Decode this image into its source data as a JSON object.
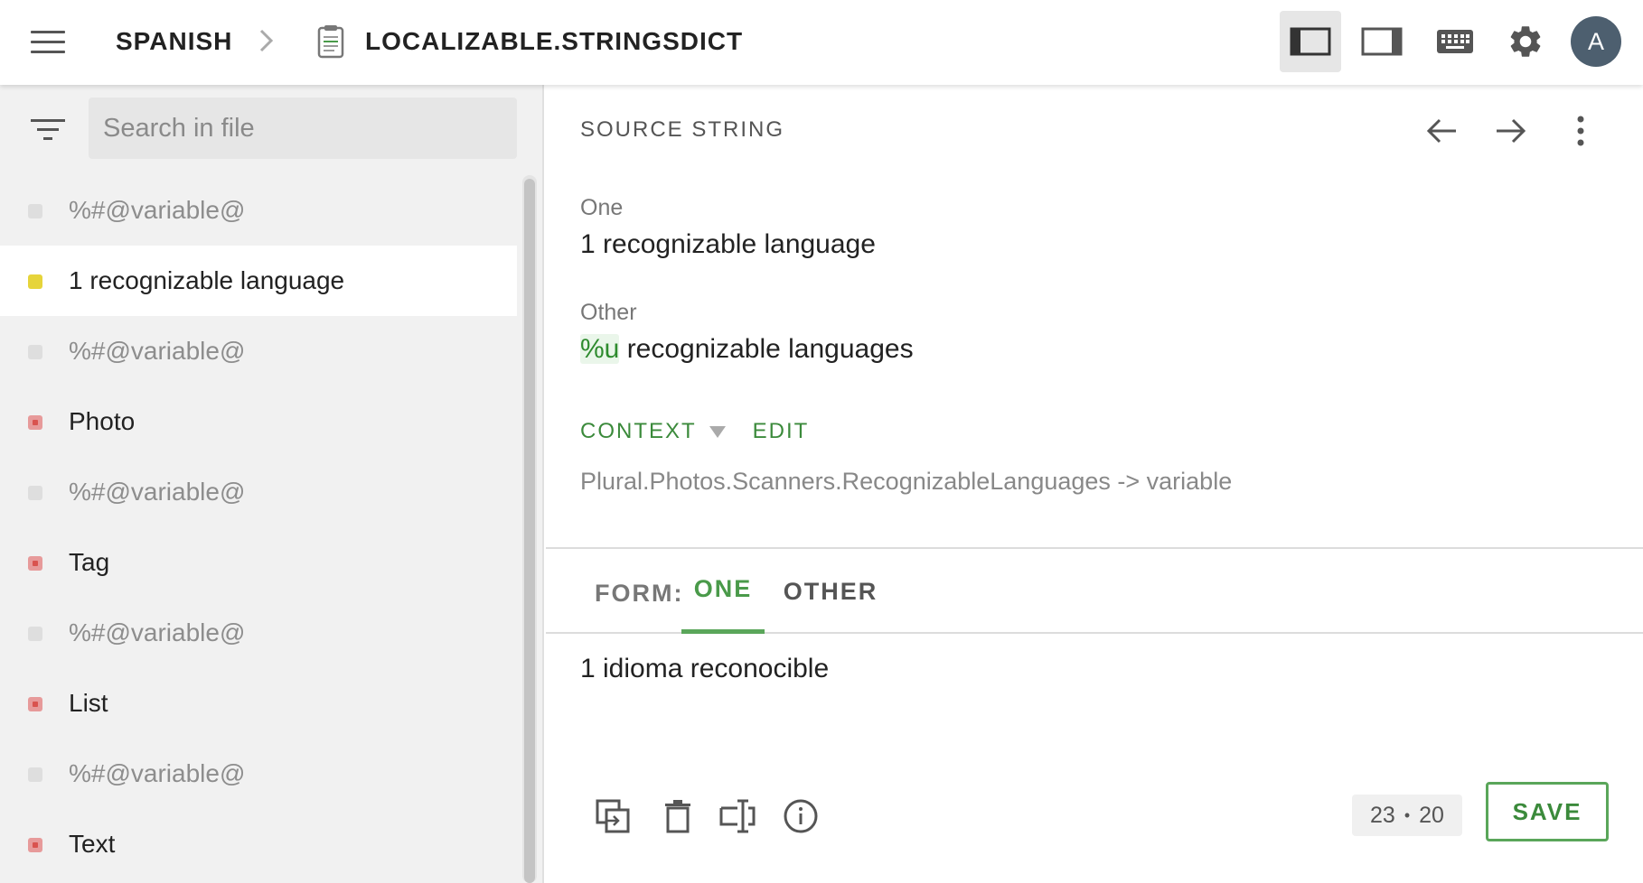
{
  "header": {
    "language": "SPANISH",
    "file_name": "LOCALIZABLE.STRINGSDICT",
    "avatar_initial": "A",
    "icons": [
      "menu-icon",
      "chevron-right-icon",
      "file-icon",
      "layout-left-panel-icon",
      "layout-right-panel-icon",
      "keyboard-icon",
      "gear-icon"
    ]
  },
  "sidebar": {
    "search_placeholder": "Search in file",
    "items": [
      {
        "label": "%#@variable@",
        "status": "gray",
        "muted": true
      },
      {
        "label": "1 recognizable language",
        "status": "yellow",
        "muted": false,
        "selected": true
      },
      {
        "label": "%#@variable@",
        "status": "gray",
        "muted": true
      },
      {
        "label": "Photo",
        "status": "red",
        "muted": false
      },
      {
        "label": "%#@variable@",
        "status": "gray",
        "muted": true
      },
      {
        "label": "Tag",
        "status": "red",
        "muted": false
      },
      {
        "label": "%#@variable@",
        "status": "gray",
        "muted": true
      },
      {
        "label": "List",
        "status": "red",
        "muted": false
      },
      {
        "label": "%#@variable@",
        "status": "gray",
        "muted": true
      },
      {
        "label": "Text",
        "status": "red",
        "muted": false
      }
    ]
  },
  "source": {
    "title": "SOURCE STRING",
    "forms": [
      {
        "label": "One",
        "text": "1 recognizable language"
      },
      {
        "label": "Other",
        "placeholder": "%u",
        "text": " recognizable languages"
      }
    ],
    "context_label": "CONTEXT",
    "edit_label": "EDIT",
    "context_text": "Plural.Photos.Scanners.RecognizableLanguages -> variable"
  },
  "editor": {
    "form_prefix": "FORM:",
    "tabs": [
      {
        "label": "ONE",
        "active": true
      },
      {
        "label": "OTHER",
        "active": false
      }
    ],
    "translation": "1 idioma reconocible",
    "source_count": "23",
    "translation_count": "20",
    "counter_separator": "•",
    "save_label": "SAVE"
  },
  "colors": {
    "accent_green": "#3b8a3b",
    "status_yellow": "#e6d43a",
    "status_red": "#d9534f",
    "avatar_bg": "#4d5f6f"
  }
}
